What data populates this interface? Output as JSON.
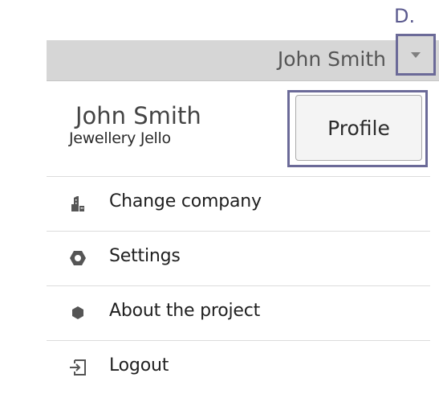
{
  "annotation": {
    "label": "D."
  },
  "header": {
    "user_name": "John Smith",
    "dropdown_icon": "caret-down-icon"
  },
  "user": {
    "name": "John Smith",
    "company": "Jewellery Jello"
  },
  "profile_button": {
    "label": "Profile"
  },
  "menu": [
    {
      "label": "Change company",
      "icon": "building-icon"
    },
    {
      "label": "Settings",
      "icon": "hexagon-icon"
    },
    {
      "label": "About the project",
      "icon": "hexagon-small-icon"
    },
    {
      "label": "Logout",
      "icon": "logout-icon"
    }
  ],
  "colors": {
    "annotation": "#6b6a98",
    "header_bg": "#d6d6d6"
  }
}
